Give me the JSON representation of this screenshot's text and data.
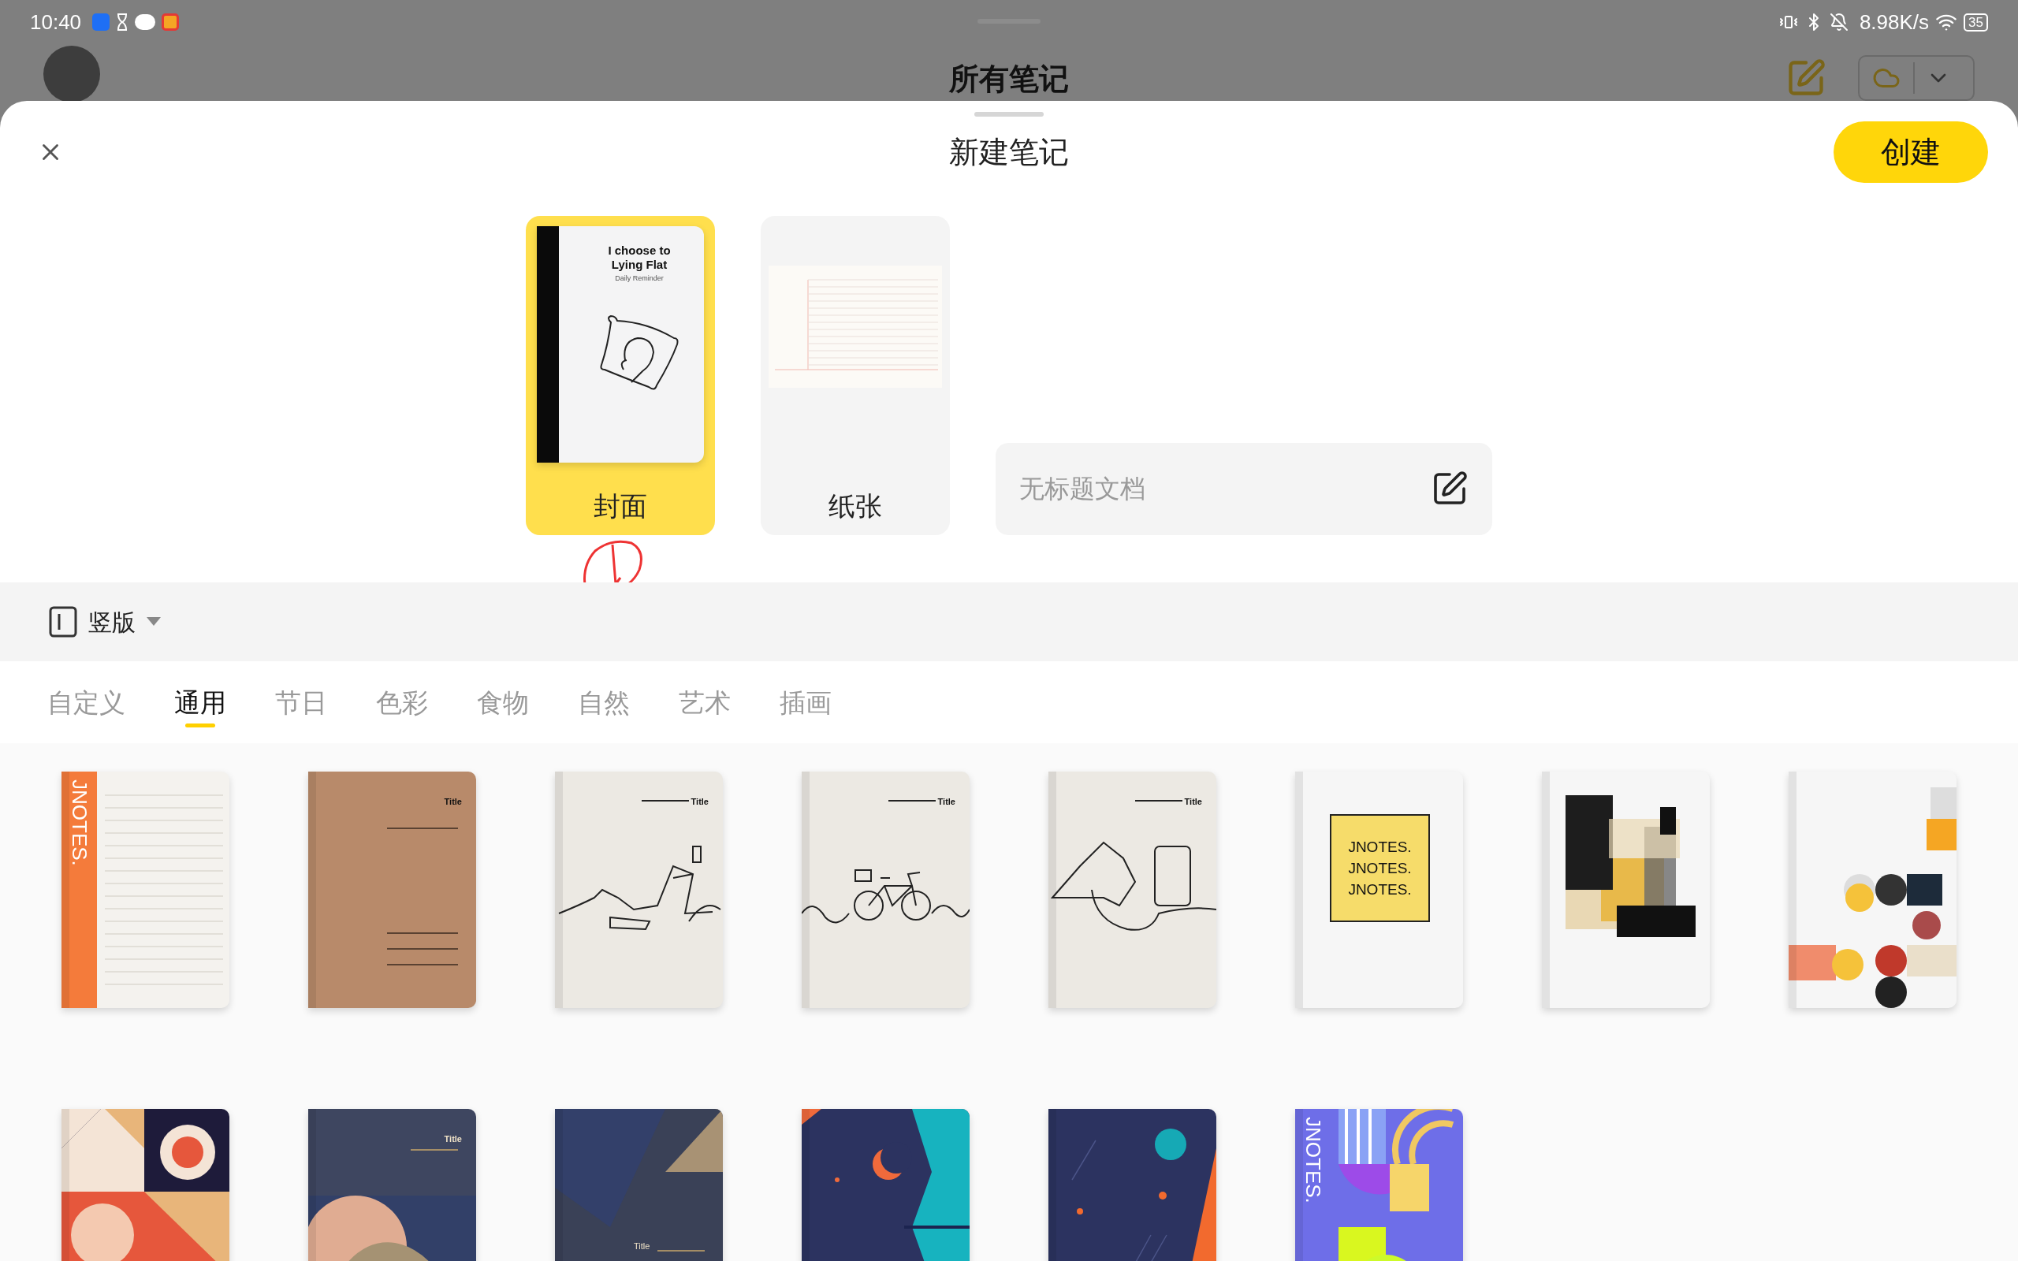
{
  "status_bar": {
    "time": "10:40",
    "network_speed": "8.98K/s",
    "battery": "35"
  },
  "app_bar": {
    "title": "所有笔记"
  },
  "sheet": {
    "title": "新建笔记",
    "create_button": "创建"
  },
  "modes": [
    {
      "label": "封面",
      "selected": true,
      "kind": "cover",
      "texts": [
        "I choose to",
        "Lying Flat",
        "Daily Reminder"
      ]
    },
    {
      "label": "纸张",
      "selected": false,
      "kind": "paper"
    }
  ],
  "title_field": {
    "placeholder": "无标题文档"
  },
  "orientation": {
    "label": "竖版"
  },
  "categories": [
    {
      "label": "自定义",
      "selected": false
    },
    {
      "label": "通用",
      "selected": true
    },
    {
      "label": "节日",
      "selected": false
    },
    {
      "label": "色彩",
      "selected": false
    },
    {
      "label": "食物",
      "selected": false
    },
    {
      "label": "自然",
      "selected": false
    },
    {
      "label": "艺术",
      "selected": false
    },
    {
      "label": "插画",
      "selected": false
    }
  ],
  "covers": [
    {
      "kind": "lined-orange",
      "texts": [
        "JNOTES."
      ]
    },
    {
      "kind": "kraft",
      "texts": [
        "Title"
      ]
    },
    {
      "kind": "sketch-desk",
      "texts": [
        "Title"
      ]
    },
    {
      "kind": "sketch-bike",
      "texts": [
        "Title"
      ]
    },
    {
      "kind": "sketch-phone",
      "texts": [
        "Title"
      ]
    },
    {
      "kind": "jnotes-yellow",
      "texts": [
        "JNOTES.",
        "JNOTES.",
        "JNOTES."
      ]
    },
    {
      "kind": "geo-blocks"
    },
    {
      "kind": "geo-circles"
    },
    {
      "kind": "geo-pattern"
    },
    {
      "kind": "navy-title",
      "texts": [
        "Title"
      ]
    },
    {
      "kind": "navy-shapes",
      "texts": [
        "Title"
      ]
    },
    {
      "kind": "space-moon"
    },
    {
      "kind": "space-planet"
    },
    {
      "kind": "jnotes-purple",
      "texts": [
        "JNOTES."
      ]
    }
  ]
}
